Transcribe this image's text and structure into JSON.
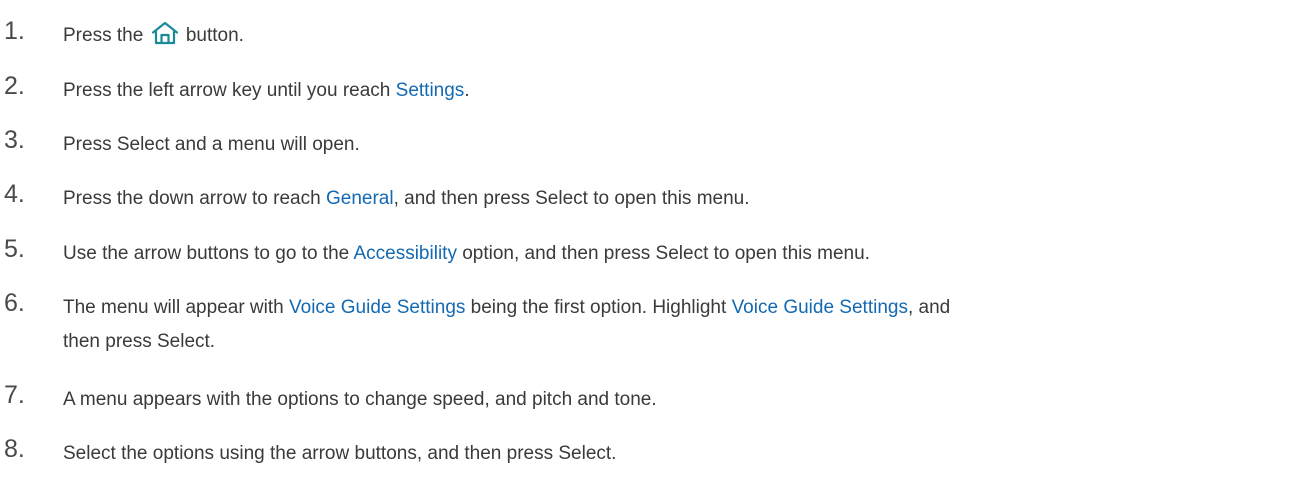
{
  "steps": [
    {
      "num": "1.",
      "before": "Press the",
      "icon": "home-icon",
      "after": "button."
    },
    {
      "num": "2.",
      "before": "Press the left arrow key until you reach ",
      "link": "Settings",
      "after": "."
    },
    {
      "num": "3.",
      "text": "Press Select and a menu will open."
    },
    {
      "num": "4.",
      "before": "Press the down arrow to reach ",
      "link": "General",
      "after": ", and then press Select to open this menu."
    },
    {
      "num": "5.",
      "before": "Use the arrow buttons to go to the ",
      "link": "Accessibility",
      "after": " option, and then press Select to open this menu."
    },
    {
      "num": "6.",
      "before": "The menu will appear with ",
      "link": "Voice Guide Settings",
      "middle": " being the first option. Highlight ",
      "link2": "Voice Guide Settings",
      "after": ", and",
      "line2": "then press Select."
    },
    {
      "num": "7.",
      "text": "A menu appears with the options to change speed, and pitch and tone."
    },
    {
      "num": "8.",
      "text": "Select the options using the arrow buttons, and then press Select."
    }
  ],
  "colors": {
    "text": "#3a3a3a",
    "link": "#1469b3",
    "icon": "#1a8a9a"
  }
}
